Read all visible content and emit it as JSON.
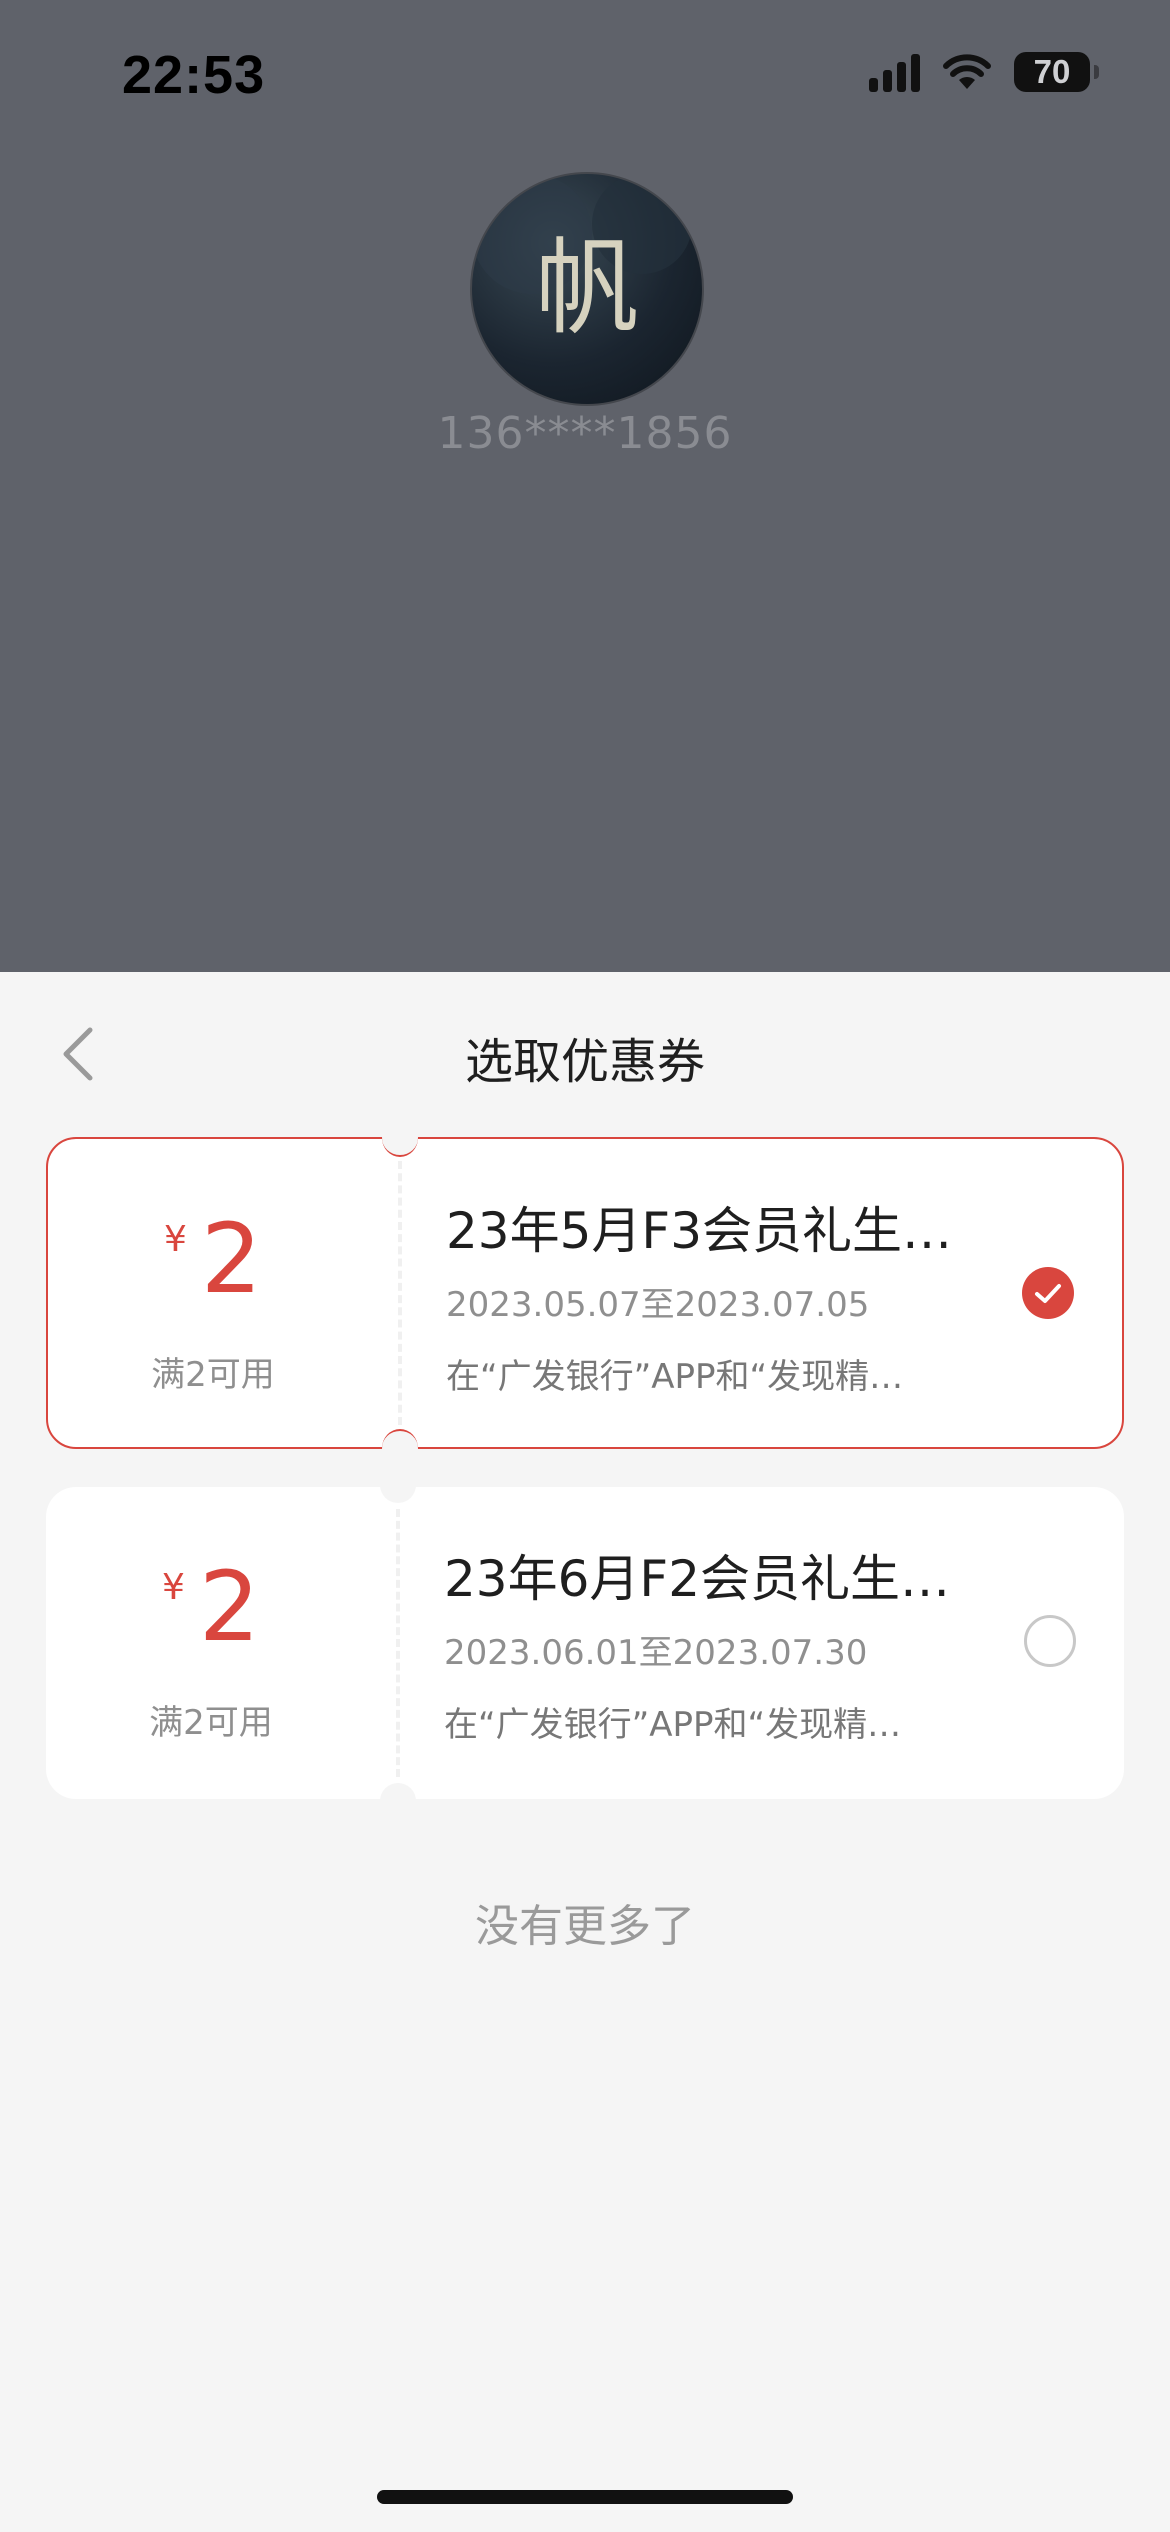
{
  "status_bar": {
    "time": "22:53",
    "battery": "70"
  },
  "profile": {
    "avatar_text": "帆",
    "phone": "136****1856"
  },
  "sheet": {
    "title": "选取优惠券",
    "no_more": "没有更多了"
  },
  "coupons": [
    {
      "currency": "¥",
      "amount": "2",
      "condition": "满2可用",
      "title": "23年5月F3会员礼生…",
      "dates": "2023.05.07至2023.07.05",
      "description": "在“广发银行”APP和“发现精…",
      "selected": true
    },
    {
      "currency": "¥",
      "amount": "2",
      "condition": "满2可用",
      "title": "23年6月F2会员礼生…",
      "dates": "2023.06.01至2023.07.30",
      "description": "在“广发银行”APP和“发现精…",
      "selected": false
    }
  ],
  "colors": {
    "accent": "#d9463e",
    "overlay": "#5f626a",
    "sheet_bg": "#f5f5f5"
  }
}
